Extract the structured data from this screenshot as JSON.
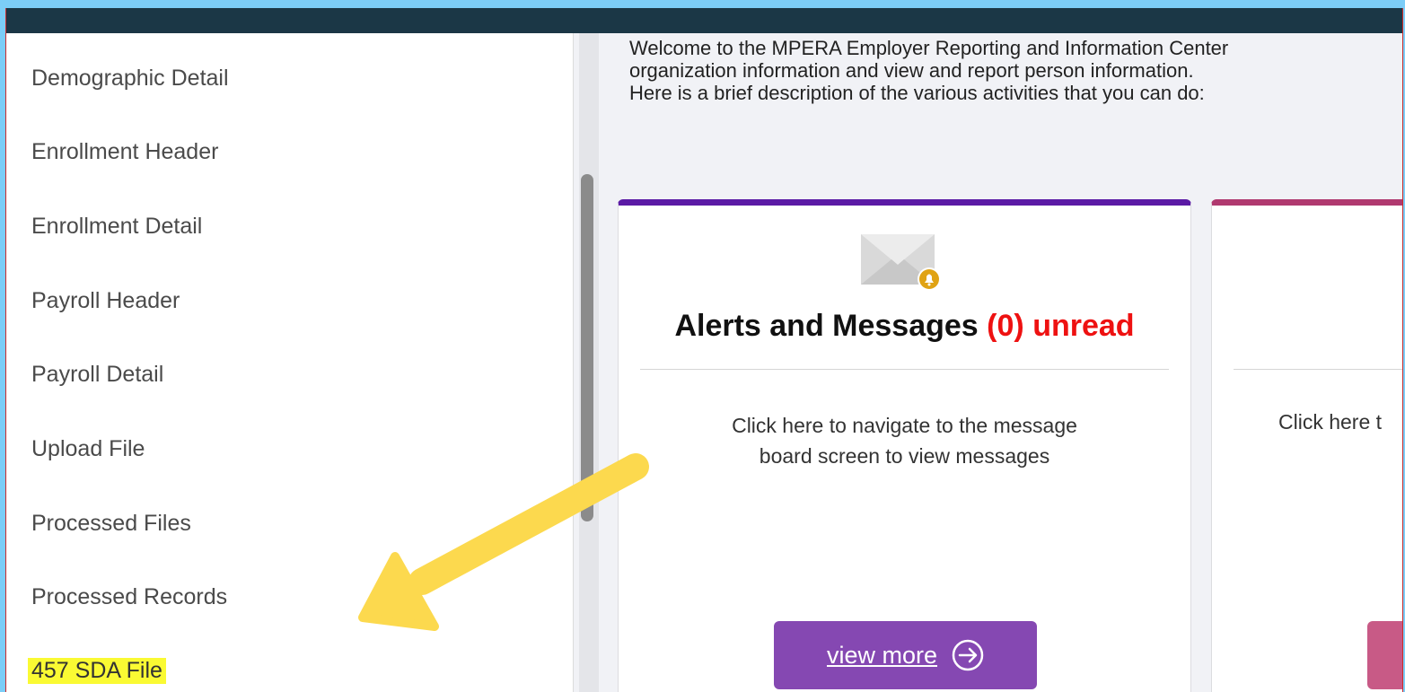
{
  "sidebar": {
    "items": [
      {
        "label": "Demographic Detail"
      },
      {
        "label": "Enrollment Header"
      },
      {
        "label": "Enrollment Detail"
      },
      {
        "label": "Payroll Header"
      },
      {
        "label": "Payroll Detail"
      },
      {
        "label": "Upload File"
      },
      {
        "label": "Processed Files"
      },
      {
        "label": "Processed Records"
      },
      {
        "label": "457 SDA File"
      }
    ],
    "highlight_color": "#fafa33"
  },
  "welcome": {
    "line1": "Welcome to the MPERA Employer Reporting and Information Center",
    "line2": "organization information and view and report person information.",
    "line3": "Here is a brief description of the various activities that you can do:"
  },
  "cards": [
    {
      "icon": "envelope-bell-icon",
      "title": "Alerts and Messages",
      "count": "(0)",
      "status": "unread",
      "description_line1": "Click here to navigate to the message",
      "description_line2": "board screen to view messages",
      "button": "view more",
      "accent": "#5b1aa5"
    },
    {
      "description": "Click here t",
      "accent": "#b0396f"
    }
  ],
  "annotation": {
    "icon": "yellow-arrow-icon",
    "color": "#fcd94e"
  }
}
